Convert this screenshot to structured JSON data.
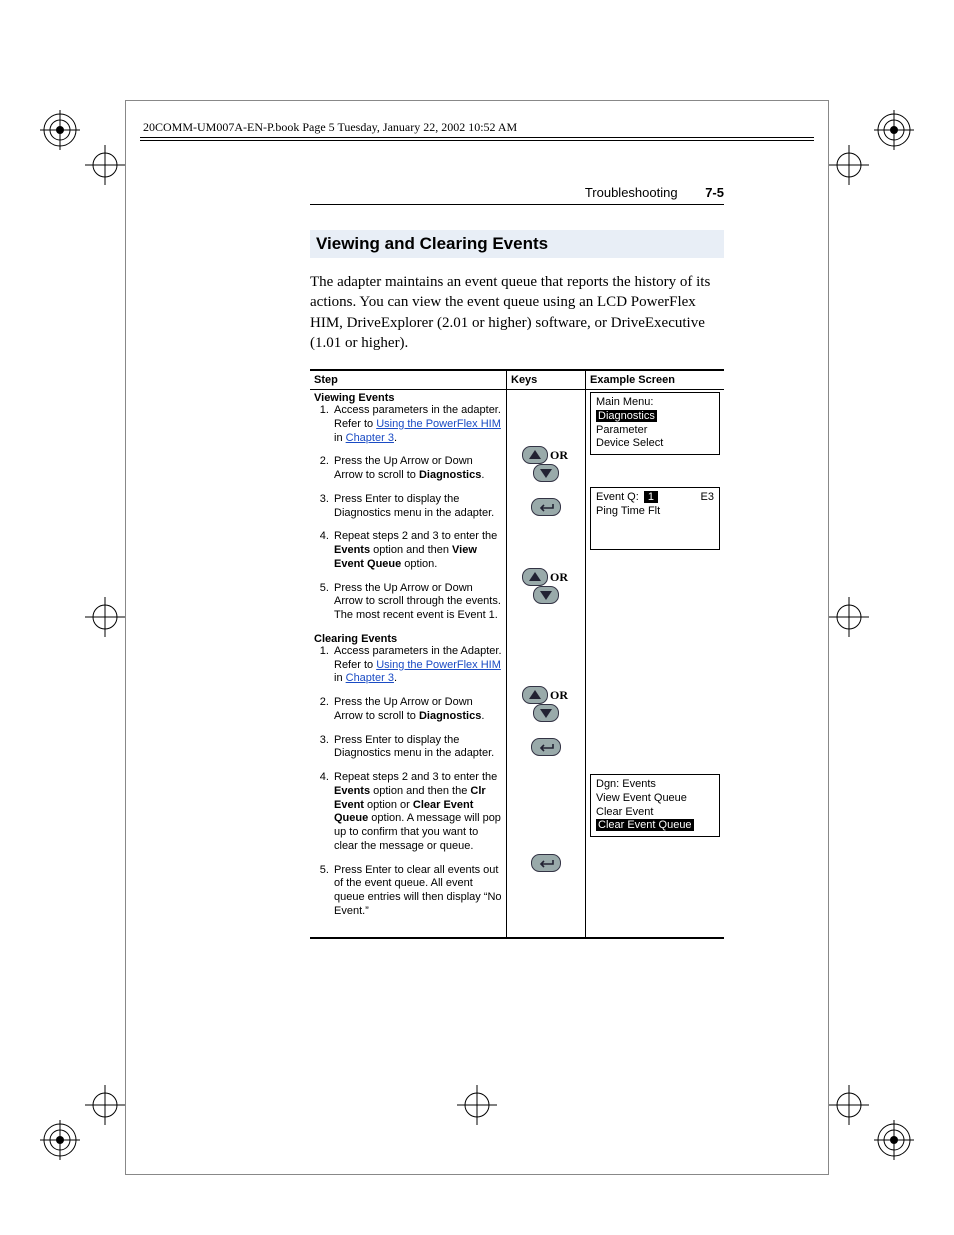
{
  "book_header": "20COMM-UM007A-EN-P.book  Page 5  Tuesday, January 22, 2002  10:52 AM",
  "running_head": {
    "title": "Troubleshooting",
    "page": "7-5"
  },
  "section_title": "Viewing and Clearing Events",
  "intro": "The adapter maintains an event queue that reports the history of its actions. You can view the event queue using an LCD PowerFlex HIM, DriveExplorer (2.01 or higher) software, or DriveExecutive (1.01 or higher).",
  "table": {
    "headers": {
      "step": "Step",
      "keys": "Keys",
      "example": "Example Screen"
    },
    "viewing_title": "Viewing Events",
    "viewing": [
      {
        "pre": "Access parameters in the adapter. Refer to ",
        "link": "Using the PowerFlex HIM",
        "mid": " in ",
        "link2": "Chapter 3",
        "post": "."
      },
      {
        "pre": "Press the Up Arrow or Down Arrow to scroll to ",
        "b1": "Diagnostics",
        "post": "."
      },
      {
        "text": "Press Enter to display the Diagnostics menu in the adapter."
      },
      {
        "pre": "Repeat steps 2 and 3 to enter the ",
        "b1": "Events",
        "mid": " option and then ",
        "b2": "View Event Queue",
        "post": " option."
      },
      {
        "text": "Press the Up Arrow or Down Arrow to scroll through the events. The most recent event is Event 1."
      }
    ],
    "clearing_title": "Clearing Events",
    "clearing": [
      {
        "pre": "Access parameters in the Adapter. Refer to ",
        "link": "Using the PowerFlex HIM",
        "mid": " in ",
        "link2": "Chapter 3",
        "post": "."
      },
      {
        "pre": "Press the Up Arrow or Down Arrow to scroll to ",
        "b1": "Diagnostics",
        "post": "."
      },
      {
        "text": "Press Enter to display the Diagnostics menu in the adapter."
      },
      {
        "pre": "Repeat steps 2 and 3 to enter the ",
        "b1": "Events",
        "mid": " option and then the ",
        "b2": "Clr Event",
        "mid2": " option or ",
        "b3": "Clear Event Queue",
        "post": " option. A message will pop up to confirm that you want to clear the message or queue."
      },
      {
        "text": "Press Enter to clear all events out of the event queue. All event queue entries will then display “No Event.”"
      }
    ],
    "or_label": "OR",
    "screen1": {
      "l1": "Main Menu:",
      "l2": "Diagnostics",
      "l3": "Parameter",
      "l4": "Device Select"
    },
    "screen2": {
      "l1a": "Event Q:",
      "l1n": "1",
      "l1b": "E3",
      "l2": "Ping Time Flt"
    },
    "screen3": {
      "l1": "Dgn: Events",
      "l2": "View Event Queue",
      "l3": "Clear Event",
      "l4": "Clear Event Queue"
    }
  }
}
